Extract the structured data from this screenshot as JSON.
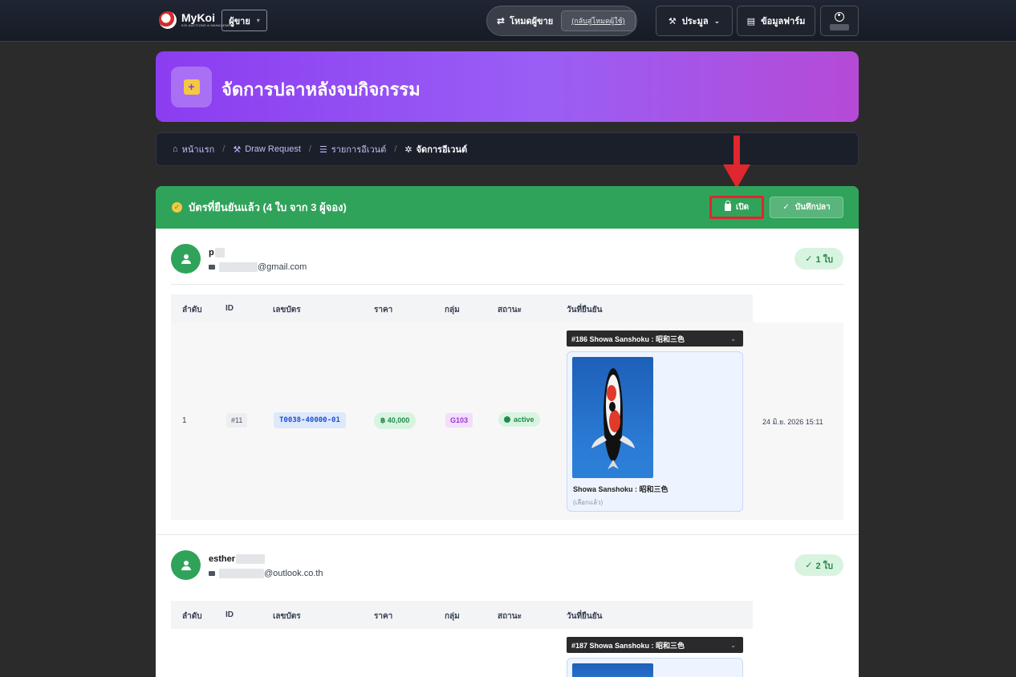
{
  "navbar": {
    "brand_name": "MyKoi",
    "brand_sub": "KOI AUCTIONS & MANAGEMENT",
    "role_select": "ผู้ขาย",
    "mode_label": "โหมดผู้ขาย",
    "mode_switch_label": "(กลับสู่โหมดผู้ใช้)",
    "auction_label": "ประมูล",
    "farm_label": "ข้อมูลฟาร์ม"
  },
  "banner": {
    "title": "จัดการปลาหลังจบกิจกรรม"
  },
  "breadcrumb": [
    {
      "label": "หน้าแรก",
      "icon": "store-icon"
    },
    {
      "label": "Draw Request",
      "icon": "gavel-icon"
    },
    {
      "label": "รายการอีเวนต์",
      "icon": "list-icon"
    },
    {
      "label": "จัดการอีเวนต์",
      "icon": "gear-icon"
    }
  ],
  "card": {
    "title": "บัตรที่ยืนยันแล้ว (4 ใบ จาก 3 ผู้จอง)",
    "open_label": "เปิด",
    "save_label": "บันทึกปลา"
  },
  "table_headers": [
    "ลำดับ",
    "ID",
    "เลขบัตร",
    "ราคา",
    "กลุ่ม",
    "สถานะ",
    "วันที่ยืนยัน"
  ],
  "groups": [
    {
      "name": "p",
      "email_suffix": "@gmail.com",
      "count": "1 ใบ",
      "rows": [
        {
          "order": "1",
          "id": "#11",
          "ticket": "T0038-40000-01",
          "price": "฿ 40,000",
          "group": "G103",
          "status": "active",
          "fish_select": "#186 Showa Sanshoku : 昭和三色",
          "fish_name": "Showa Sanshoku : 昭和三色",
          "fish_state": "(เลือกแล้ว)",
          "confirmed_at": "24 มิ.ย. 2026 15:11"
        }
      ]
    },
    {
      "name": "esther",
      "email_suffix": "@outlook.co.th",
      "count": "2 ใบ",
      "rows": [
        {
          "fish_select": "#187 Showa Sanshoku : 昭和三色"
        }
      ]
    }
  ],
  "colors": {
    "banner_gradient_start": "#8b3df0",
    "banner_gradient_end": "#b54ad6",
    "card_header": "#30a35a",
    "highlight_box": "#e0262e"
  }
}
